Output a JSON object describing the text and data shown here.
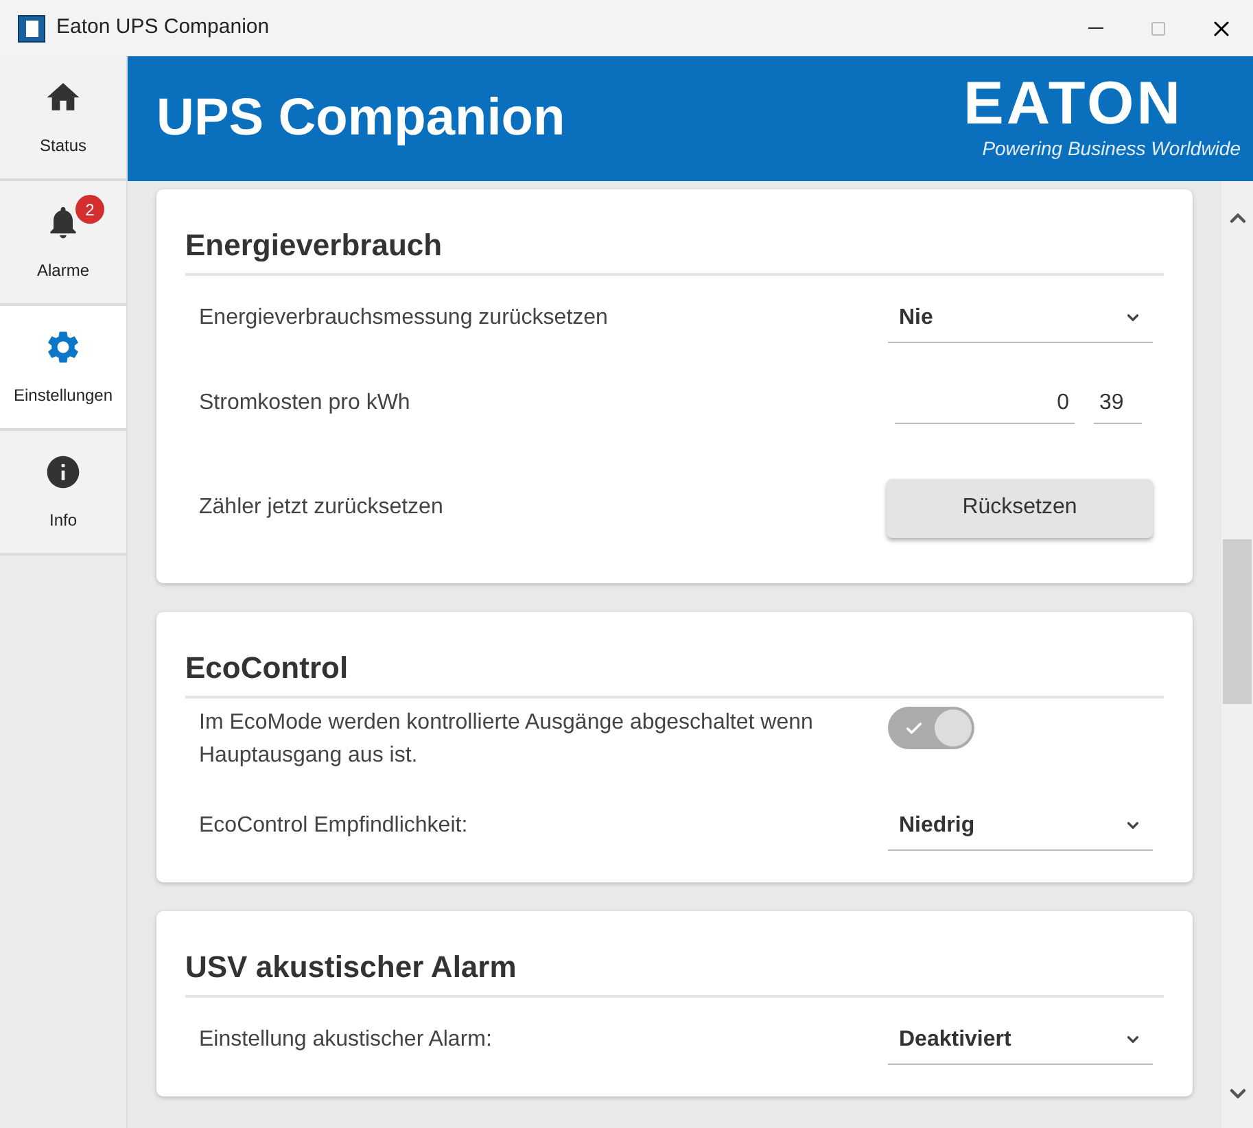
{
  "window": {
    "title": "Eaton UPS Companion"
  },
  "sidebar": {
    "items": [
      {
        "label": "Status",
        "kind": "home",
        "selected": false
      },
      {
        "label": "Alarme",
        "kind": "bell",
        "selected": false,
        "badge": "2"
      },
      {
        "label": "Einstellungen",
        "kind": "gear",
        "selected": true
      },
      {
        "label": "Info",
        "kind": "info",
        "selected": false
      }
    ]
  },
  "header": {
    "title": "UPS Companion",
    "logo": "EATON",
    "tagline": "Powering Business Worldwide"
  },
  "sections": [
    {
      "title": "Energieverbrauch",
      "rows": [
        {
          "kind": "select",
          "label": "Energieverbrauchsmessung zurücksetzen",
          "value": "Nie"
        },
        {
          "kind": "price",
          "label": "Stromkosten pro kWh",
          "whole": "0",
          "fraction": "39"
        },
        {
          "kind": "button",
          "label": "Zähler jetzt zurücksetzen",
          "button": "Rücksetzen"
        }
      ]
    },
    {
      "title": "EcoControl",
      "rows": [
        {
          "kind": "toggle",
          "label": "Im EcoMode werden kontrollierte Ausgänge abgeschaltet wenn Hauptausgang aus ist.",
          "on": true
        },
        {
          "kind": "select",
          "label": "EcoControl Empfindlichkeit:",
          "value": "Niedrig"
        }
      ]
    },
    {
      "title": "USV akustischer Alarm",
      "rows": [
        {
          "kind": "select",
          "label": "Einstellung akustischer Alarm:",
          "value": "Deaktiviert"
        }
      ]
    }
  ]
}
